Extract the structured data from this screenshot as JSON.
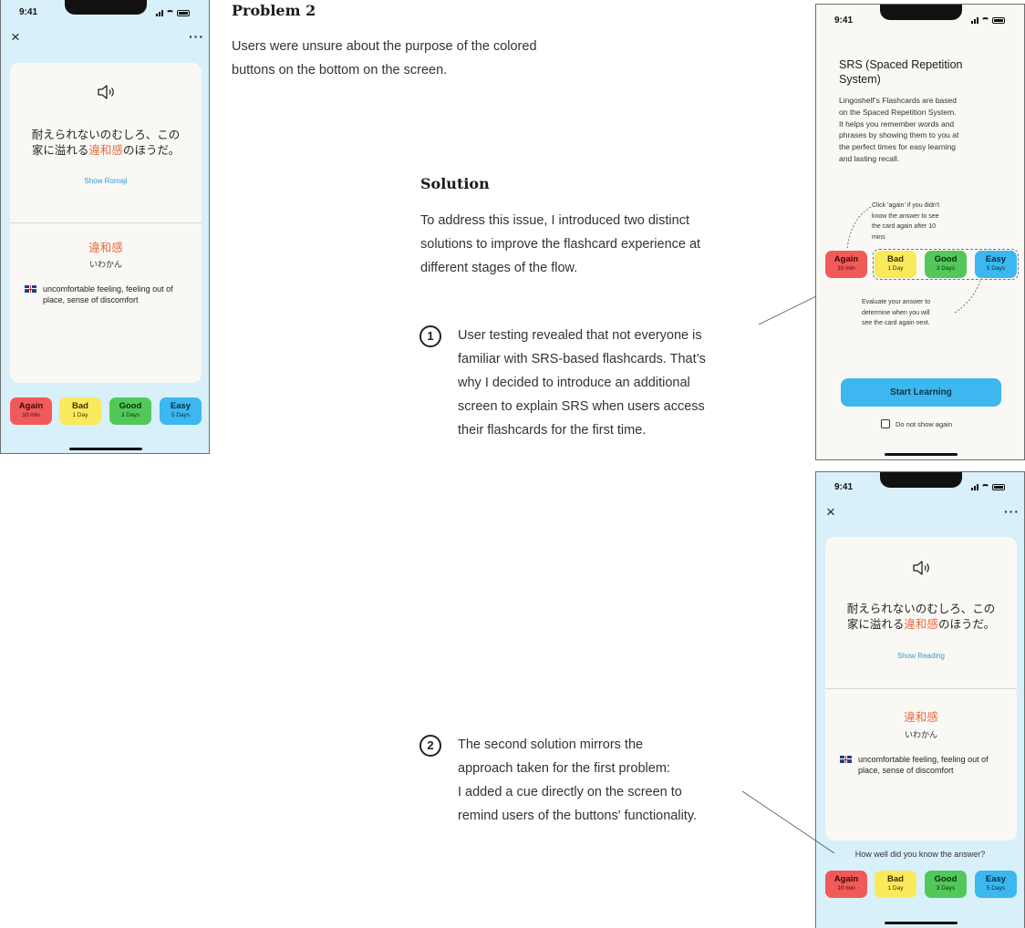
{
  "status": {
    "time": "9:41"
  },
  "toolbar": {
    "close_icon": "×",
    "more_icon": "···"
  },
  "card": {
    "speaker_icon": "speaker-icon",
    "sentence_before": "耐えられないのむしろ、この",
    "sentence_mid": "家に溢れる",
    "sentence_highlight": "違和感",
    "sentence_after": "のほうだ。",
    "word": "違和感",
    "reading": "いわかん",
    "meaning": "uncomfortable feeling, feeling out of place, sense of discomfort"
  },
  "phone1": {
    "show_link": "Show Romaji"
  },
  "phone3": {
    "show_link": "Show Reading",
    "question": "How well did you know the answer?"
  },
  "buttons": [
    {
      "label": "Again",
      "sub": "10 min",
      "color": "#f25a5a"
    },
    {
      "label": "Bad",
      "sub": "1 Day",
      "color": "#fbe95c"
    },
    {
      "label": "Good",
      "sub": "3 Days",
      "color": "#52c85a"
    },
    {
      "label": "Easy",
      "sub": "5 Days",
      "color": "#3cb7ef"
    }
  ],
  "problem": {
    "title": "Problem 2",
    "text_line1": "Users were unsure about the purpose of the colored",
    "text_line2": "buttons on the bottom on the screen."
  },
  "solution": {
    "title": "Solution",
    "text_line1": "To address this issue, I introduced two distinct",
    "text_line2": "solutions to improve the flashcard experience at",
    "text_line3": "different stages of the flow."
  },
  "point1": {
    "number": "1",
    "line1": "User testing revealed that not everyone is",
    "line2": "familiar with SRS-based flashcards. That’s",
    "line3": "why I decided to introduce an additional",
    "line4": "screen to explain SRS when users access",
    "line5": "their flashcards for the first time."
  },
  "point2": {
    "number": "2",
    "line1": "The second solution mirrors the",
    "line2": "approach taken for the first problem:",
    "line3": "I added a cue directly on the screen to",
    "line4": "remind users of the buttons' functionality."
  },
  "srs_screen": {
    "title_line1": "SRS (Spaced Repetition",
    "title_line2": "System)",
    "body_line1": "Lingoshelf’s Flashcards are based",
    "body_line2": "on the Spaced Repetition System.",
    "body_line3": "It helps you remember words and",
    "body_line4": "phrases by showing them to you at",
    "body_line5": "the perfect times for easy learning",
    "body_line6": "and lasting recall.",
    "note_top_line1": "Click 'again' if you didn't",
    "note_top_line2": "know the answer to see",
    "note_top_line3": "the card again after 10",
    "note_top_line4": "mins",
    "note_bottom_line1": "Evaluate your answer to",
    "note_bottom_line2": "determine when you will",
    "note_bottom_line3": "see the card again next.",
    "start_button": "Start Learning",
    "checkbox_label": "Do not show again"
  }
}
